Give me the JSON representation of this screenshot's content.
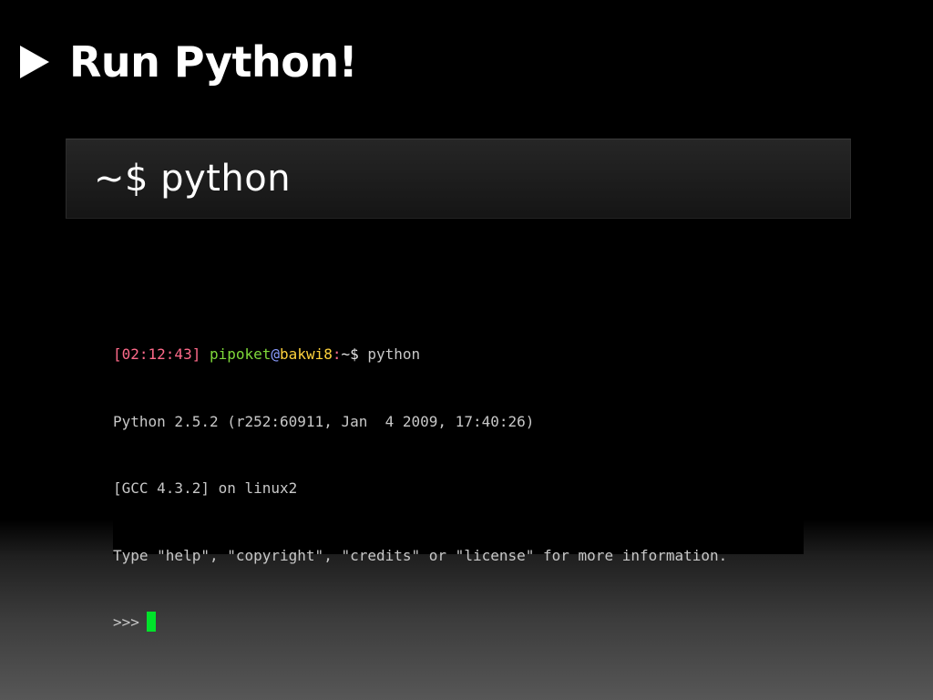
{
  "slide": {
    "title": "Run Python!",
    "command": "~$ python"
  },
  "terminal": {
    "prompt": {
      "time": "[02:12:43]",
      "user": "pipoket",
      "at": "@",
      "host": "bakwi8",
      "colon": ":",
      "path": "~$",
      "command": " python"
    },
    "lines": [
      "Python 2.5.2 (r252:60911, Jan  4 2009, 17:40:26)",
      "[GCC 4.3.2] on linux2",
      "Type \"help\", \"copyright\", \"credits\" or \"license\" for more information."
    ],
    "repl_prompt": ">>>"
  },
  "colors": {
    "time": "#ff6a8a",
    "user": "#7fd93a",
    "at": "#8a9cff",
    "host": "#ffd23c",
    "colon": "#ff6a8a",
    "path": "#e8e8e8",
    "text": "#c8c8c8",
    "cursor": "#00e22a"
  },
  "icons": {
    "bullet": "triangle-right-icon"
  }
}
